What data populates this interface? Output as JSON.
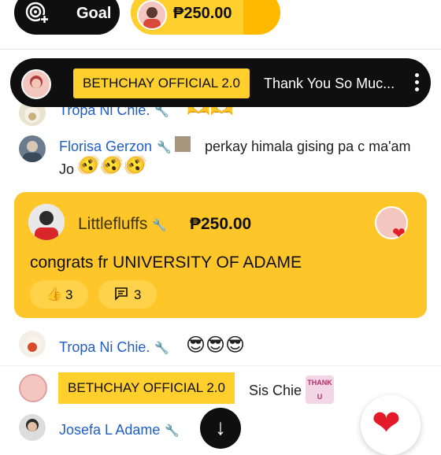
{
  "header": {
    "goal_label": "Goal",
    "goal_icon": "goal-add-icon",
    "amount": "₱250.00",
    "goal_progress": 0.75
  },
  "pinned": {
    "badge": "BETHCHAY OFFICIAL 2.0",
    "message": "Thank You So Muc...",
    "more_icon": "more-vertical-icon"
  },
  "chat": [
    {
      "author": "Tropa Ni Chie.",
      "message": "🫶🫶"
    },
    {
      "author": "Florisa Gerzon",
      "message_line1": "perkay himala gising pa c ma'am",
      "message_line2": "Jo",
      "emojis": "🫨🫨🫨"
    },
    {
      "author": "Tropa Ni Chie.",
      "message": "😎😎😎"
    },
    {
      "author": "BETHCHAY OFFICIAL 2.0",
      "message": "Sis Chie"
    },
    {
      "author": "Josefa L Adame",
      "message": ""
    }
  ],
  "super_chat": {
    "author": "Littlefluffs",
    "amount": "₱250.00",
    "message": "congrats fr UNIVERSITY OF ADAME",
    "likes": "3",
    "replies": "3",
    "colors": {
      "card": "#ffc629",
      "pill": "#ffd24a"
    }
  },
  "sticker_text": "THANK U"
}
